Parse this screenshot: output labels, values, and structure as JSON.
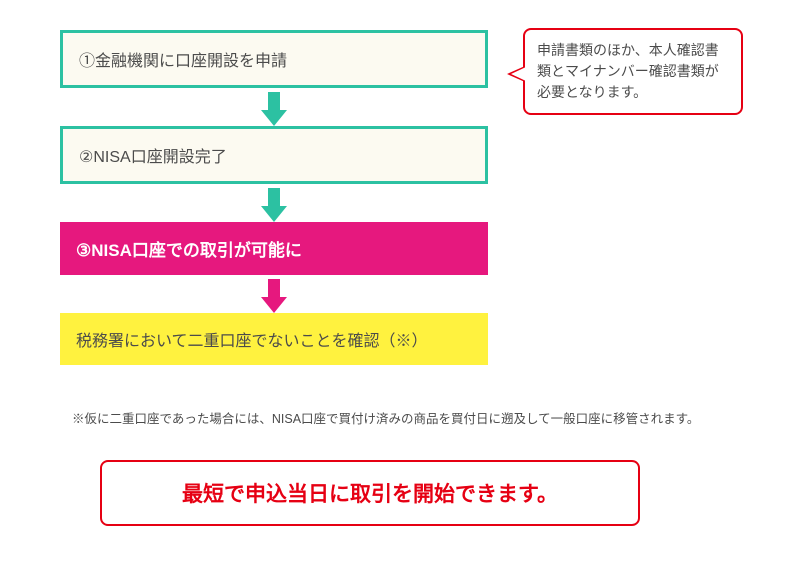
{
  "colors": {
    "teal": "#2cc1a2",
    "magenta": "#e6187e",
    "yellow": "#fff23f",
    "red": "#e60013"
  },
  "steps": {
    "s1": "①金融機関に口座開設を申請",
    "s2": "②NISA口座開設完了",
    "s3": "③NISA口座での取引が可能に",
    "s4": "税務署において二重口座でないことを確認（※）"
  },
  "callout": "申請書類のほか、本人確認書類とマイナンバー確認書類が必要となります。",
  "note": "※仮に二重口座であった場合には、NISA口座で買付け済みの商品を買付日に遡及して一般口座に移管されます。",
  "final": "最短で申込当日に取引を開始できます。"
}
